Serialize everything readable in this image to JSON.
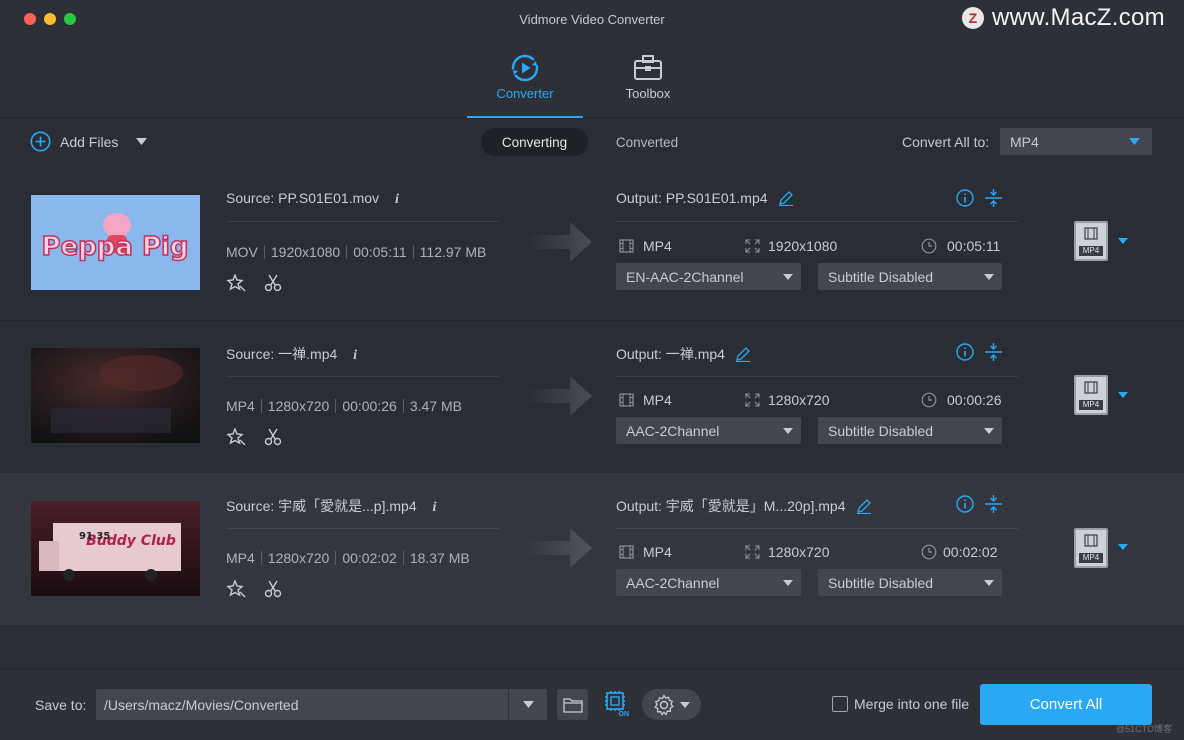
{
  "window": {
    "title": "Vidmore Video Converter"
  },
  "watermark": {
    "logo": "Z",
    "text": "www.MacZ.com"
  },
  "nav": {
    "tabs": [
      {
        "label": "Converter",
        "active": true
      },
      {
        "label": "Toolbox",
        "active": false
      }
    ]
  },
  "toolbar": {
    "add_files": "Add Files",
    "segments": [
      "Converting",
      "Converted"
    ],
    "convert_all_label": "Convert All to:",
    "convert_all_value": "MP4"
  },
  "files": [
    {
      "source": "Source: PP.S01E01.mov",
      "meta": [
        "MOV",
        "1920x1080",
        "00:05:11",
        "112.97 MB"
      ],
      "output": "Output: PP.S01E01.mp4",
      "out_format": "MP4",
      "out_resolution": "1920x1080",
      "out_duration": "00:05:11",
      "audio": "EN-AAC-2Channel",
      "subtitle": "Subtitle Disabled",
      "format_badge": "MP4",
      "thumb_text": "Peppa Pig"
    },
    {
      "source": "Source: 一禅.mp4",
      "meta": [
        "MP4",
        "1280x720",
        "00:00:26",
        "3.47 MB"
      ],
      "output": "Output: 一禅.mp4",
      "out_format": "MP4",
      "out_resolution": "1280x720",
      "out_duration": "00:00:26",
      "audio": "AAC-2Channel",
      "subtitle": "Subtitle Disabled",
      "format_badge": "MP4",
      "thumb_text": ""
    },
    {
      "source": "Source: 宇威「愛就是...p].mp4",
      "meta": [
        "MP4",
        "1280x720",
        "00:02:02",
        "18.37 MB"
      ],
      "output": "Output: 宇威「愛就是」M...20p].mp4",
      "out_format": "MP4",
      "out_resolution": "1280x720",
      "out_duration": "00:02:02",
      "audio": "AAC-2Channel",
      "subtitle": "Subtitle Disabled",
      "format_badge": "MP4",
      "thumb_text": "Buddy Club"
    }
  ],
  "footer": {
    "save_to_label": "Save to:",
    "save_to_path": "/Users/macz/Movies/Converted",
    "hw_badge": "ON",
    "merge_label": "Merge into one file",
    "convert_all": "Convert All"
  },
  "credit": "@51CTO博客",
  "colors": {
    "accent": "#29a9f3",
    "bg": "#2b2d35",
    "row_alt": "#34363f",
    "field": "#44464f"
  }
}
